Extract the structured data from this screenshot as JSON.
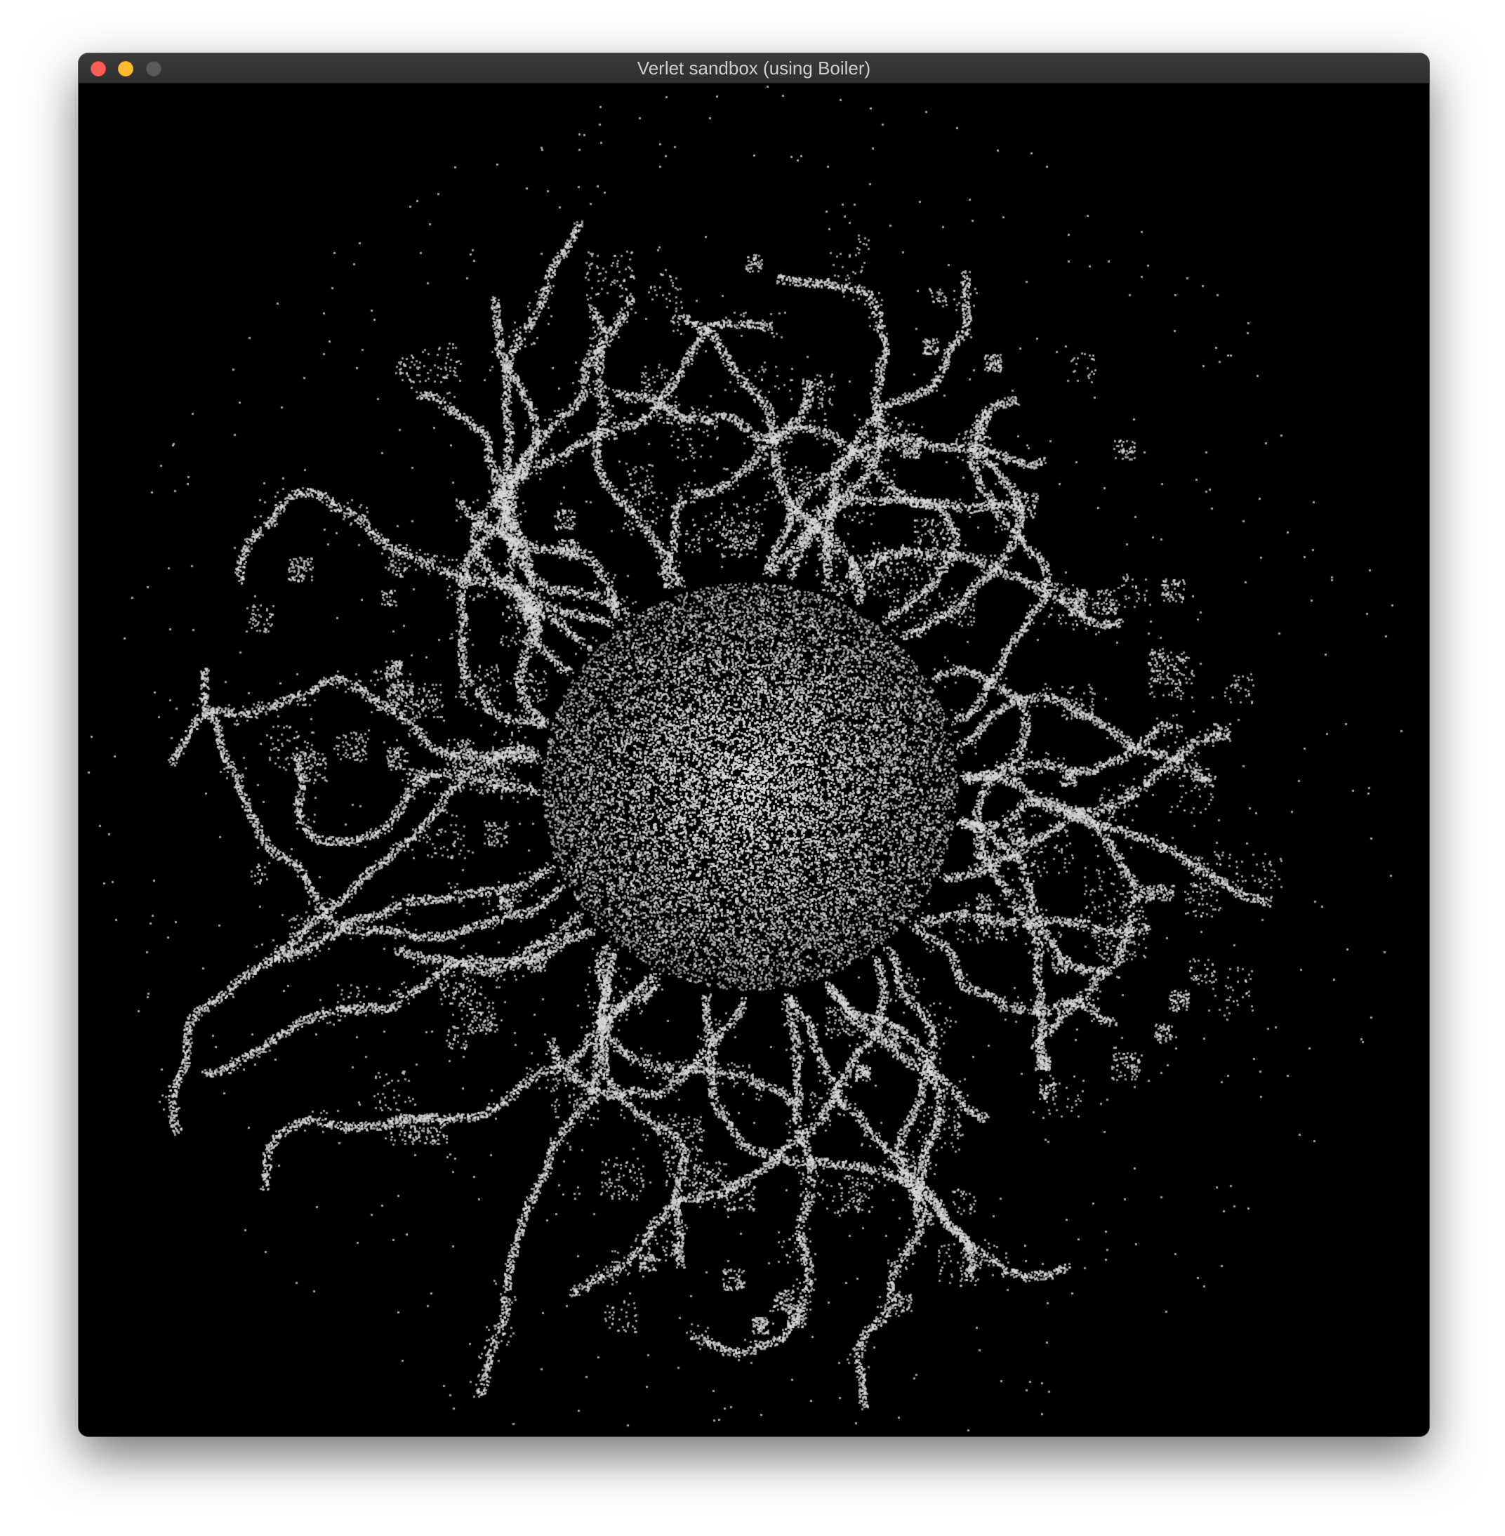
{
  "window": {
    "title": "Verlet sandbox (using Boiler)",
    "controls": {
      "close_color": "#ff5f57",
      "minimize_color": "#febc2e",
      "maximize_color": "#5a5a5a"
    }
  },
  "canvas": {
    "background": "#000000",
    "particle_color": "#d8d8d8",
    "icon": "particle-simulation"
  }
}
